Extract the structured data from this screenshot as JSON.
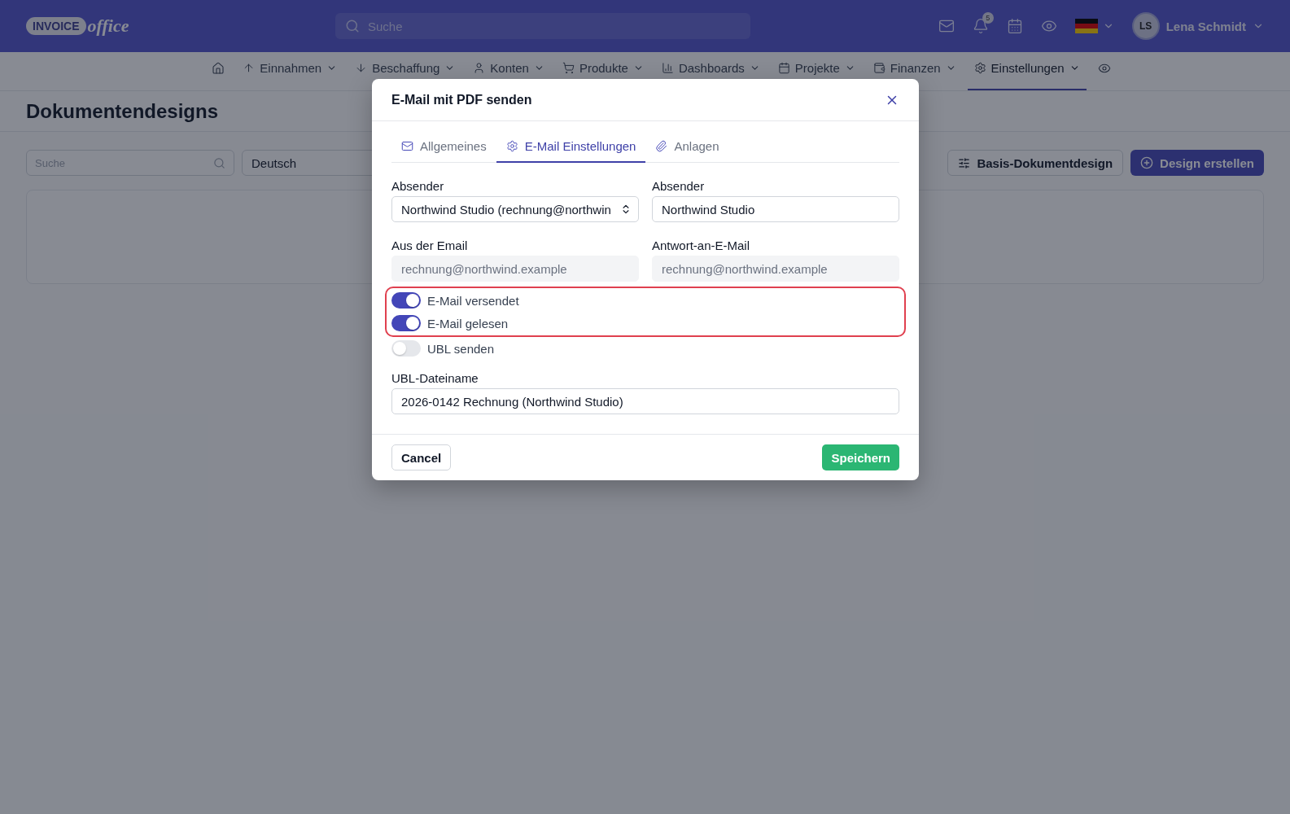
{
  "header": {
    "logo": {
      "word1": "INVOICE",
      "word2": "office"
    },
    "search": {
      "placeholder": "Suche"
    },
    "notifications": {
      "count": "5"
    },
    "user": {
      "initials": "LS",
      "name": "Lena Schmidt"
    }
  },
  "nav": [
    {
      "label": "Einnahmen",
      "selected": false
    },
    {
      "label": "Beschaffung",
      "selected": false
    },
    {
      "label": "Konten",
      "selected": false
    },
    {
      "label": "Produkte",
      "selected": false
    },
    {
      "label": "Dashboards",
      "selected": false
    },
    {
      "label": "Projekte",
      "selected": false
    },
    {
      "label": "Finanzen",
      "selected": false
    },
    {
      "label": "Einstellungen",
      "selected": true
    }
  ],
  "page": {
    "title": "Dokumentendesigns",
    "search": {
      "placeholder": "Suche"
    },
    "language": "Deutsch",
    "buttons": [
      {
        "label": "Basis-Dokumentdesign",
        "kind": "secondary"
      },
      {
        "label": "Design erstellen",
        "kind": "primary"
      }
    ]
  },
  "dialog": {
    "title": "E-Mail mit PDF senden",
    "tabs": [
      {
        "label": "Allgemeines",
        "selected": false
      },
      {
        "label": "E-Mail Einstellungen",
        "selected": true
      },
      {
        "label": "Anlagen",
        "selected": false
      }
    ],
    "fields": [
      {
        "label": "Absender",
        "value": "Northwind Studio (rechnung@northwin",
        "kind": "select",
        "disabled": false
      },
      {
        "label": "Absender",
        "value": "Northwind Studio",
        "kind": "text",
        "disabled": false
      },
      {
        "label": "Aus der Email",
        "value": "rechnung@northwind.example",
        "kind": "text",
        "disabled": true
      },
      {
        "label": "Antwort-an-E-Mail",
        "value": "rechnung@northwind.example",
        "kind": "text",
        "disabled": true
      }
    ],
    "toggles": [
      {
        "label": "E-Mail versendet",
        "on": true,
        "highlighted": true
      },
      {
        "label": "E-Mail gelesen",
        "on": true,
        "highlighted": true
      },
      {
        "label": "UBL senden",
        "on": false,
        "highlighted": false
      }
    ],
    "filename": {
      "label": "UBL-Dateiname",
      "value": "2026-0142 Rechnung (Northwind Studio)"
    },
    "buttons": [
      {
        "label": "Cancel",
        "kind": "secondary"
      },
      {
        "label": "Speichern",
        "kind": "success"
      }
    ]
  }
}
